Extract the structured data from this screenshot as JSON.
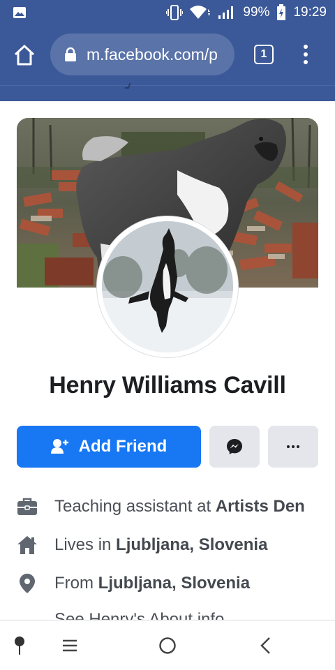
{
  "status_bar": {
    "battery": "99%",
    "time": "19:29"
  },
  "browser": {
    "url": "m.facebook.com/p",
    "tab_count": "1"
  },
  "profile": {
    "name": "Henry Williams Cavill"
  },
  "actions": {
    "add_friend": "Add Friend"
  },
  "intro": {
    "work_prefix": "Teaching assistant at ",
    "work_place": "Artists Den",
    "lives_prefix": "Lives in ",
    "lives_place": "Ljubljana, Slovenia",
    "from_prefix": "From ",
    "from_place": "Ljubljana, Slovenia",
    "about_link": "See Henry's About info"
  },
  "colors": {
    "facebook_blue": "#3b5998",
    "button_blue": "#1877f2",
    "button_grey": "#e4e6eb"
  },
  "icons": {
    "status_left": "image-icon",
    "vibrate": "vibrate-icon",
    "wifi": "wifi-icon",
    "signal": "signal-icon",
    "battery": "battery-charging-icon",
    "home": "home-icon",
    "lock": "lock-icon",
    "menu": "overflow-menu-icon",
    "add_friend": "add-person-icon",
    "messenger": "messenger-icon",
    "more": "more-icon",
    "work": "briefcase-icon",
    "lives": "house-icon",
    "from": "location-pin-icon",
    "nav_assistant": "pin-icon",
    "nav_recents": "recents-icon",
    "nav_home": "home-circle-icon",
    "nav_back": "back-icon"
  }
}
